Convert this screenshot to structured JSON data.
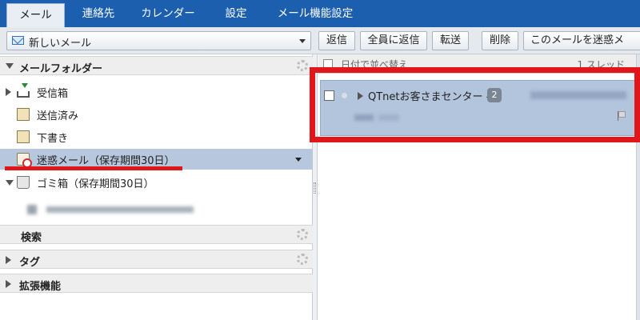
{
  "tabs": [
    {
      "label": "メール",
      "active": true
    },
    {
      "label": "連絡先",
      "active": false
    },
    {
      "label": "カレンダー",
      "active": false
    },
    {
      "label": "設定",
      "active": false
    },
    {
      "label": "メール機能設定",
      "active": false
    }
  ],
  "toolbar": {
    "new_mail_label": "新しいメール",
    "buttons": [
      "返信",
      "全員に返信",
      "転送",
      "削除",
      "このメールを迷惑メ"
    ]
  },
  "folders_section": {
    "title": "メールフォルダー",
    "items": [
      {
        "label": "受信箱",
        "icon": "inbox-icon",
        "selected": false
      },
      {
        "label": "送信済み",
        "icon": "sent-folder-icon",
        "selected": false
      },
      {
        "label": "下書き",
        "icon": "draft-folder-icon",
        "selected": false
      },
      {
        "label": "迷惑メール（保存期間30日）",
        "icon": "spam-folder-icon",
        "selected": true
      },
      {
        "label": "ゴミ箱（保存期間30日）",
        "icon": "trash-icon",
        "selected": false
      }
    ]
  },
  "search_section": {
    "title": "検索"
  },
  "tags_section": {
    "title": "タグ"
  },
  "extensions_section": {
    "title": "拡張機能"
  },
  "message_list": {
    "header_sort": "日付で並べ替え",
    "header_threads": "1 スレッド",
    "messages": [
      {
        "sender": "QTnetお客さまセンター -",
        "count": "2"
      }
    ]
  },
  "colors": {
    "topbar": "#1b5fae",
    "selection": "#b7c8de",
    "highlight_annotation": "#e0161a"
  }
}
